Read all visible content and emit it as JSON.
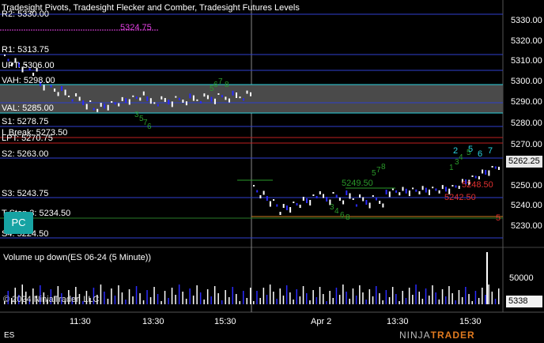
{
  "header": {
    "title": "Tradesight Pivots, Tradesight Flecker and Comber, Tradesight Futures Levels",
    "r2_label": "R2: 5330.00"
  },
  "levels": {
    "r1": "R1: 5313.75",
    "upt": "UPT: 5306.00",
    "vah": "VAH: 5298.00",
    "val": "VAL: 5285.00",
    "s1": "S1: 5278.75",
    "lbreak": "L Break: 5273.50",
    "lpt": "LPT: 5270.75",
    "s2": "S2: 5263.00",
    "s3": "S3: 5243.75",
    "tstop": "T Stop 3: 5234.50",
    "s4": "S4: 5224.50",
    "magenta": "5324.75"
  },
  "annotations": {
    "n5249": "5249.50",
    "n5248": "5248.50",
    "n5242": "5242.50",
    "n_num5": "5",
    "blue2": "2",
    "blue5": "5",
    "blue6": "6",
    "blue7": "7"
  },
  "price_axis": {
    "ticks": [
      "5330.00",
      "5320.00",
      "5310.00",
      "5300.00",
      "5290.00",
      "5280.00",
      "5270.00",
      "5250.00",
      "5240.00",
      "5230.00"
    ],
    "last": "5262.25"
  },
  "volume": {
    "title": "Volume up down(ES 06-24 (5 Minute))",
    "tick": "50000",
    "last": "5338",
    "copyright": "© 2024 NinjaTrader, LLC"
  },
  "time_axis": {
    "labels": [
      "11:30",
      "13:30",
      "15:30",
      "Apr 2",
      "13:30",
      "15:30"
    ]
  },
  "footer": {
    "instrument": "ES",
    "logo_a": "NINJA",
    "logo_b": "TRADER"
  },
  "pc_button": "PC",
  "colors": {
    "up": "#ffffff",
    "down": "#2222ff",
    "level_blue": "#2f3fcf",
    "value_area": "#4a4a4a",
    "cyan": "#2ad3e0",
    "magenta": "#e040e0",
    "red": "#e03030",
    "green": "#2a9a2a"
  }
}
